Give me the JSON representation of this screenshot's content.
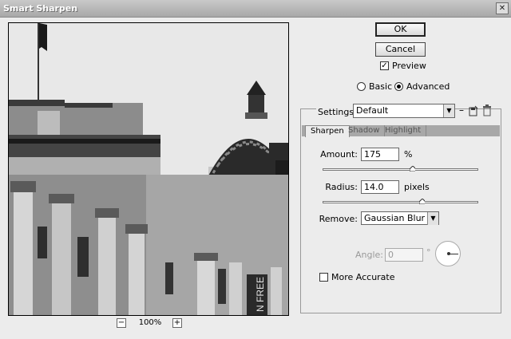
{
  "window": {
    "title": "Smart Sharpen",
    "close_glyph": "✕"
  },
  "preview": {
    "zoom_out": "−",
    "zoom_in": "+",
    "zoom_level": "100%",
    "banner_text": "N FREE"
  },
  "buttons": {
    "ok": "OK",
    "cancel": "Cancel"
  },
  "options": {
    "preview_label": "Preview",
    "preview_checked": "✓",
    "basic_label": "Basic",
    "advanced_label": "Advanced"
  },
  "settings": {
    "label": "Settings:",
    "value": "Default",
    "save_icon": "save-icon",
    "delete_icon": "trash-icon"
  },
  "tabs": [
    {
      "label": "Sharpen"
    },
    {
      "label": "Shadow"
    },
    {
      "label": "Highlight"
    }
  ],
  "sharpen": {
    "amount_label": "Amount:",
    "amount_value": "175",
    "amount_unit": "%",
    "amount_slider": 0.58,
    "radius_label": "Radius:",
    "radius_value": "14.0",
    "radius_unit": "pixels",
    "radius_slider": 0.64,
    "remove_label": "Remove:",
    "remove_value": "Gaussian Blur",
    "angle_label": "Angle:",
    "angle_value": "0",
    "angle_unit": "°",
    "more_accurate_label": "More Accurate"
  }
}
